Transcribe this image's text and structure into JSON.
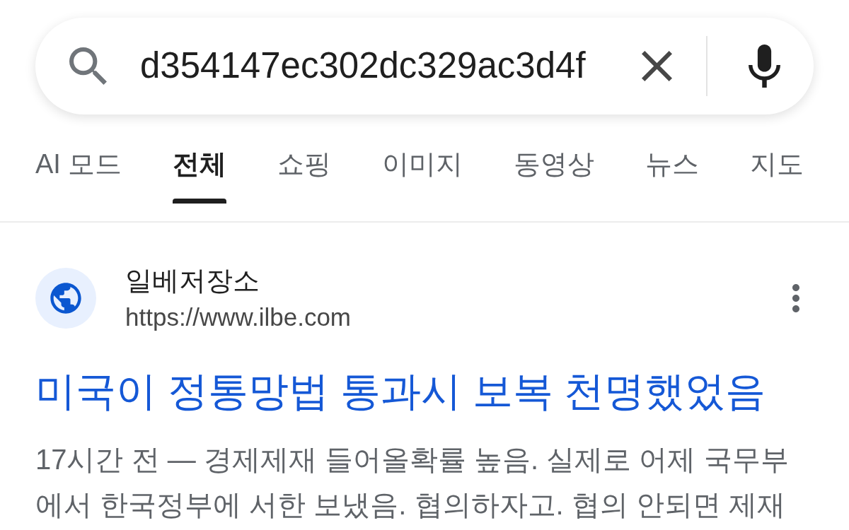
{
  "search": {
    "value": "d354147ec302dc329ac3d4f"
  },
  "tabs": [
    {
      "label": "AI 모드",
      "selected": false
    },
    {
      "label": "전체",
      "selected": true
    },
    {
      "label": "쇼핑",
      "selected": false
    },
    {
      "label": "이미지",
      "selected": false
    },
    {
      "label": "동영상",
      "selected": false
    },
    {
      "label": "뉴스",
      "selected": false
    },
    {
      "label": "지도",
      "selected": false
    }
  ],
  "results": [
    {
      "site_name": "일베저장소",
      "url": "https://www.ilbe.com",
      "title": "미국이 정통망법 통과시 보복 천명했었음",
      "snippet": "17시간 전 — 경제제재 들어올확률 높음. 실제로 어제 국무부에서 한국정부에 서한 보냈음. 협의하자고. 협의 안되면 제재"
    }
  ]
}
